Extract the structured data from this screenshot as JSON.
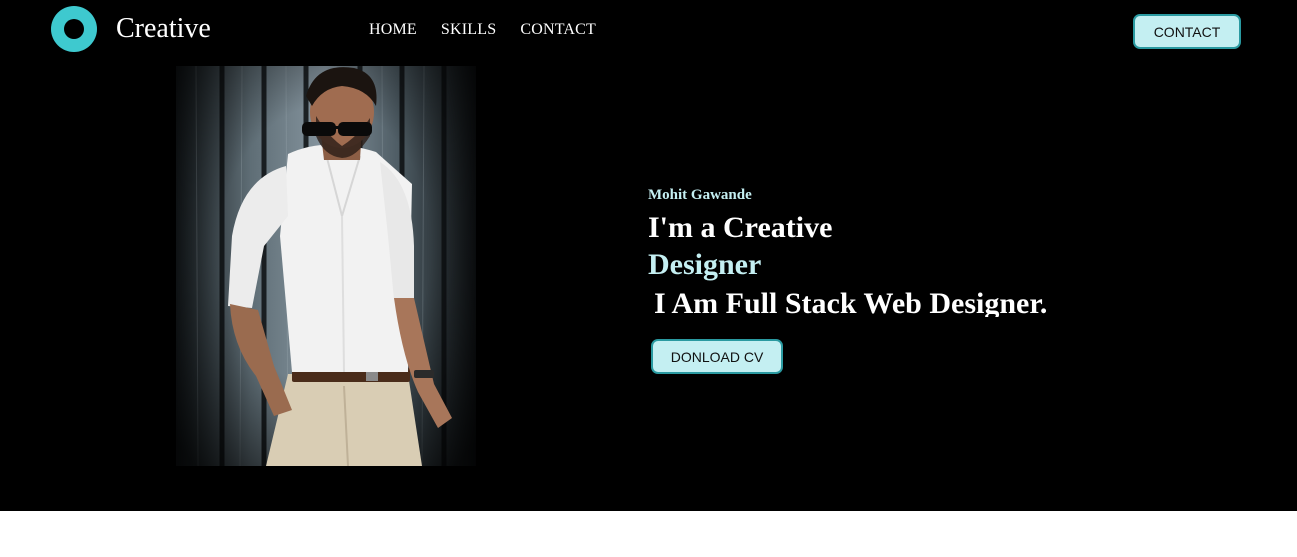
{
  "header": {
    "brand": "Creative",
    "nav": [
      "HOME",
      "SKILLS",
      "CONTACT"
    ],
    "contact_button": "CONTACT"
  },
  "hero": {
    "name": "Mohit Gawande",
    "headline_line1": "I'm a Creative",
    "headline_line2": "Designer",
    "headline_line3": "I Am Full Stack Web Designer.",
    "download_button": "DONLOAD CV"
  },
  "colors": {
    "accent": "#3ec9cf",
    "accent_light": "#c4eff2",
    "background": "#000000"
  }
}
